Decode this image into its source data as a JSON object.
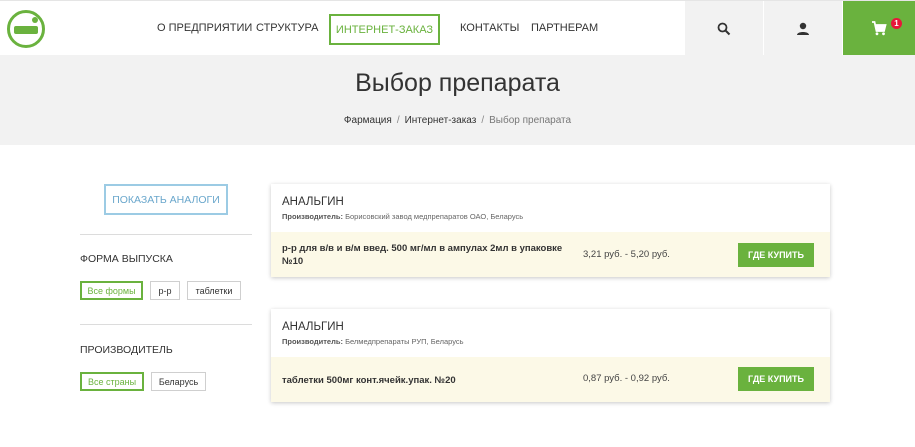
{
  "header": {
    "nav": [
      "О предприятии",
      "Структура",
      "Интернет-заказ",
      "Контакты",
      "Партнерам"
    ],
    "cart_count": "1",
    "icons": {
      "search": "search-icon",
      "user": "user-icon",
      "cart": "cart-icon",
      "logo": "logo-icon"
    },
    "colors": {
      "accent": "#6ab23e",
      "badge": "#e8163a"
    }
  },
  "hero": {
    "title": "Выбор препарата",
    "breadcrumbs": [
      "Фармация",
      "Интернет-заказ",
      "Выбор препарата"
    ]
  },
  "sidebar": {
    "analog_button": "Показать аналоги",
    "form_title": "Форма выпуска",
    "form_chips": [
      "Все формы",
      "р-р",
      "таблетки"
    ],
    "maker_title": "Производитель",
    "maker_chips": [
      "Все страны",
      "Беларусь"
    ]
  },
  "products": [
    {
      "name": "Анальгин",
      "maker_label": "Производитель:",
      "maker": "Борисовский завод медпрепаратов ОАО, Беларусь",
      "desc_line1": "р-р для в/в и в/м введ. 500 мг/мл в ампулах 2мл в упаковке",
      "desc_line2": "№10",
      "price": "3,21 руб. - 5,20 руб.",
      "buy": "Где купить"
    },
    {
      "name": "Анальгин",
      "maker_label": "Производитель:",
      "maker": "Белмедпрепараты РУП, Беларусь",
      "desc_line1": "таблетки 500мг конт.ячейк.упак. №20",
      "price": "0,87 руб. - 0,92 руб.",
      "buy": "Где купить"
    }
  ]
}
